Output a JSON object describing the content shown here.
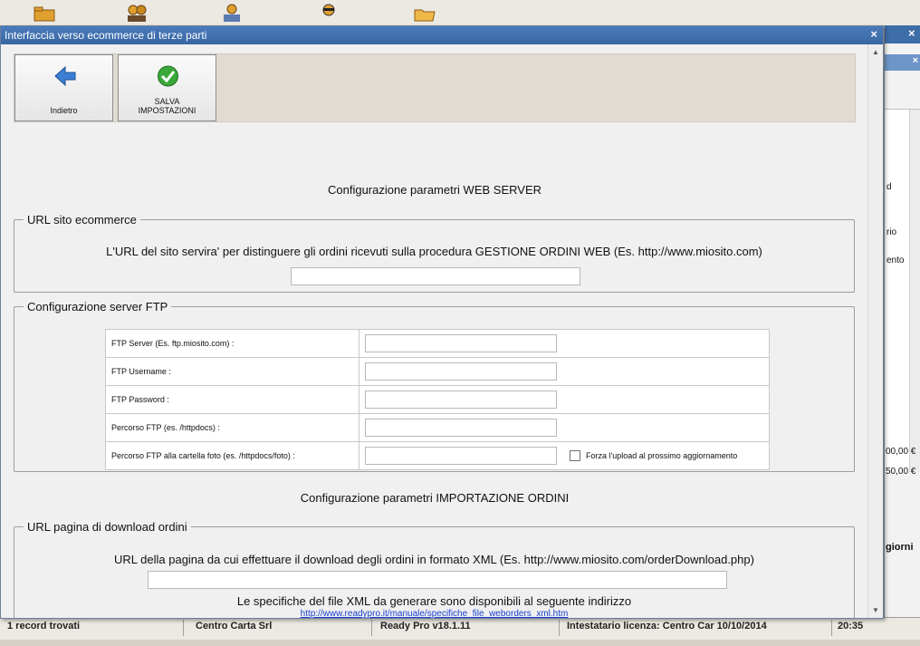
{
  "background": {
    "toolbar_icons": [
      "folder-icon",
      "users-icon",
      "user-tools-icon",
      "person-icon",
      "open-folder-icon"
    ],
    "right_window": {
      "fragments": [
        "d",
        "rio",
        "ento",
        "00,00 €",
        "50,00 €",
        "giorni"
      ]
    },
    "status_bar": {
      "cells": [
        "1 record trovati",
        "Centro Carta Srl",
        "Ready Pro v18.1.11",
        "Intestatario licenza: Centro Car 10/10/2014",
        "20:35"
      ]
    }
  },
  "modal": {
    "title": "Interfaccia verso ecommerce di terze parti",
    "close_glyph": "×",
    "toolbar": {
      "back_label": "Indietro",
      "save_label_line1": "SALVA",
      "save_label_line2": "IMPOSTAZIONI"
    },
    "web_server_title": "Configurazione parametri WEB SERVER",
    "url_site": {
      "legend": "URL sito ecommerce",
      "description": "L'URL del sito servira' per distinguere gli ordini ricevuti sulla procedura GESTIONE ORDINI WEB (Es. http://www.miosito.com)",
      "value": ""
    },
    "ftp": {
      "legend": "Configurazione server FTP",
      "rows": [
        {
          "label": "FTP Server (Es. ftp.miosito.com) :",
          "value": ""
        },
        {
          "label": "FTP Username :",
          "value": ""
        },
        {
          "label": "FTP Password :",
          "value": ""
        },
        {
          "label": "Percorso FTP (es. /httpdocs) :",
          "value": ""
        },
        {
          "label": "Percorso FTP alla cartella foto (es. /httpdocs/foto) :",
          "value": ""
        }
      ],
      "force_upload_label": "Forza l'upload al prossimo aggiornamento",
      "force_upload_checked": false
    },
    "import_title": "Configurazione parametri IMPORTAZIONE ORDINI",
    "download": {
      "legend": "URL pagina di download ordini",
      "description": "URL della pagina da cui effettuare il download degli ordini in formato XML (Es. http://www.miosito.com/orderDownload.php)",
      "value": "",
      "spec_text": "Le specifiche del file XML da generare sono disponibili al seguente indirizzo",
      "spec_link": "http://www.readypro.it/manuale/specifiche_file_weborders_xml.htm"
    }
  },
  "colors": {
    "title_bar": "#3866a4",
    "back_arrow": "#3b7fd4",
    "save_check": "#3aa83a",
    "link": "#1a3ecf"
  }
}
